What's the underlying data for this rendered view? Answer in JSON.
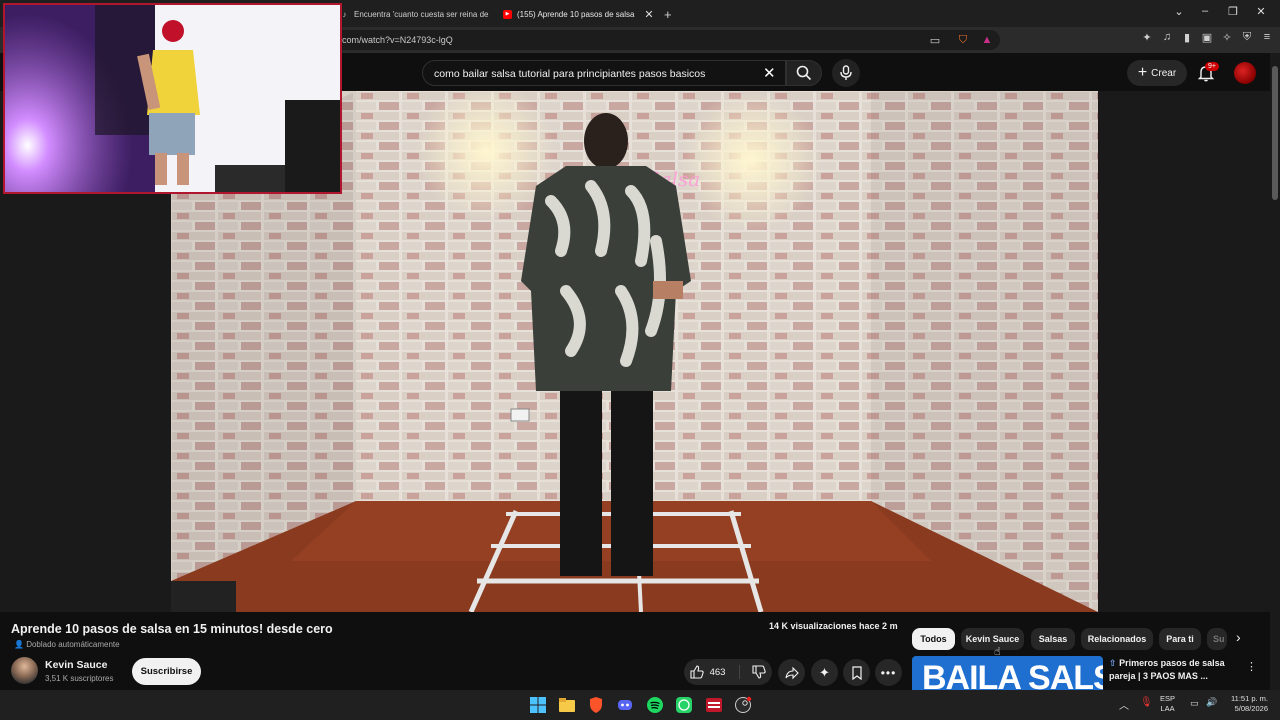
{
  "browser": {
    "tabs": [
      {
        "label": "Encuentra 'cuanto cuesta ser reina de",
        "icon": "tiktok-icon"
      },
      {
        "label": "(155) Aprende 10 pasos de salsa",
        "icon": "youtube-icon",
        "active": true
      }
    ],
    "url": "com/watch?v=N24793c-lgQ"
  },
  "youtube": {
    "search": {
      "query": "como bailar salsa tutorial para principiantes pasos basicos"
    },
    "create_label": "Crear",
    "notification_badge": "9+"
  },
  "video": {
    "title": "Aprende 10 pasos de salsa en 15 minutos! desde cero",
    "dubbed": "Doblado automáticamente",
    "views": "14 K visualizaciones  hace 2 m",
    "channel": {
      "name": "Kevin Sauce",
      "subscribers": "3,51 K suscriptores"
    },
    "subscribe_label": "Suscribirse",
    "likes": "463"
  },
  "chips": [
    "Todos",
    "Kevin Sauce",
    "Salsas",
    "Relacionados",
    "Para ti",
    "Su"
  ],
  "recommendation": {
    "title": "Primeros pasos de salsa pareja | 3 PAOS MAS ...",
    "thumb_text": "BAILA SALSA"
  },
  "taskbar": {
    "lang_line1": "ESP",
    "lang_line2": "LAA",
    "time": "11:51 p. m.",
    "date": "5/08/2026"
  },
  "colors": {
    "accent": "#ff0000",
    "webcam_border": "#b0162d"
  }
}
